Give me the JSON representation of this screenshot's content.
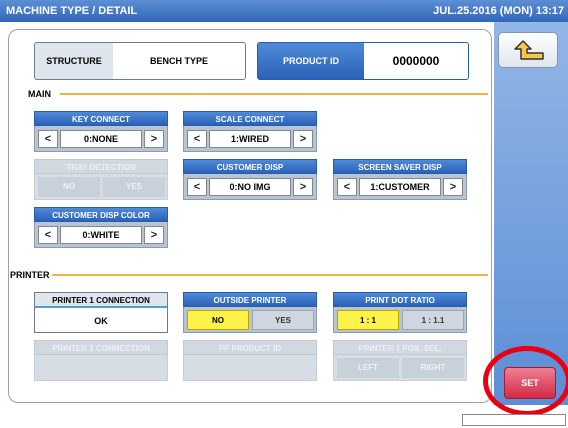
{
  "titlebar": {
    "title": "MACHINE TYPE / DETAIL",
    "datetime": "JUL.25.2016 (MON) 13:17"
  },
  "structure": {
    "label": "STRUCTURE",
    "value": "BENCH TYPE"
  },
  "product": {
    "label": "PRODUCT ID",
    "value": "0000000"
  },
  "sections": {
    "main": "MAIN",
    "printer": "PRINTER"
  },
  "main": {
    "key_connect": {
      "title": "KEY CONNECT",
      "value": "0:NONE"
    },
    "scale_connect": {
      "title": "SCALE CONNECT",
      "value": "1:WIRED"
    },
    "tray_detection": {
      "title": "TRAY DETECTION",
      "options": [
        "NO",
        "YES"
      ]
    },
    "customer_disp": {
      "title": "CUSTOMER DISP",
      "value": "0:NO IMG"
    },
    "screen_saver_disp": {
      "title": "SCREEN SAVER DISP",
      "value": "1:CUSTOMER"
    },
    "customer_disp_color": {
      "title": "CUSTOMER DISP COLOR",
      "value": "0:WHITE"
    }
  },
  "printer": {
    "printer1_connection": {
      "title": "PRINTER 1 CONNECTION",
      "value": "OK"
    },
    "outside_printer": {
      "title": "OUTSIDE PRINTER",
      "options": [
        "NO",
        "YES"
      ],
      "selected": "NO"
    },
    "print_dot_ratio": {
      "title": "PRINT DOT RATIO",
      "options": [
        "1 : 1",
        "1 : 1.1"
      ],
      "selected": "1 : 1"
    },
    "printer2_connection": {
      "title": "PRINTER 2 CONNECTION"
    },
    "pp_product_id": {
      "title": "PP PRODUCT ID"
    },
    "printer1_pos_sel": {
      "title": "PRINTER 1 POS. SEL.",
      "options": [
        "LEFT",
        "RIGHT"
      ]
    }
  },
  "buttons": {
    "set": "SET"
  },
  "arrows": {
    "left": "<",
    "right": ">"
  },
  "icons": {
    "back": "return-arrow-icon"
  },
  "colors": {
    "accent": "#2f66b8",
    "selected": "#fff24a",
    "set": "#d42945",
    "highlight_ring": "#e60012",
    "rule": "#f4b24a"
  }
}
